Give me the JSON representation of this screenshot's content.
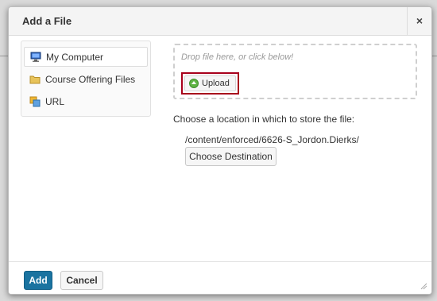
{
  "dialog": {
    "title": "Add a File",
    "close_label": "×"
  },
  "sources": [
    {
      "label": "My Computer",
      "icon": "computer-icon",
      "active": true
    },
    {
      "label": "Course Offering Files",
      "icon": "folder-icon",
      "active": false
    },
    {
      "label": "URL",
      "icon": "link-icon",
      "active": false
    }
  ],
  "dropzone": {
    "hint": "Drop file here, or click below!",
    "upload_label": "Upload"
  },
  "location": {
    "prompt": "Choose a location in which to store the file:",
    "path": "/content/enforced/6626-S_Jordon.Dierks/",
    "choose_label": "Choose Destination"
  },
  "footer": {
    "add_label": "Add",
    "cancel_label": "Cancel"
  },
  "colors": {
    "primary": "#1a73a0",
    "highlight": "#a8001b",
    "upload_icon": "#5fb344"
  }
}
